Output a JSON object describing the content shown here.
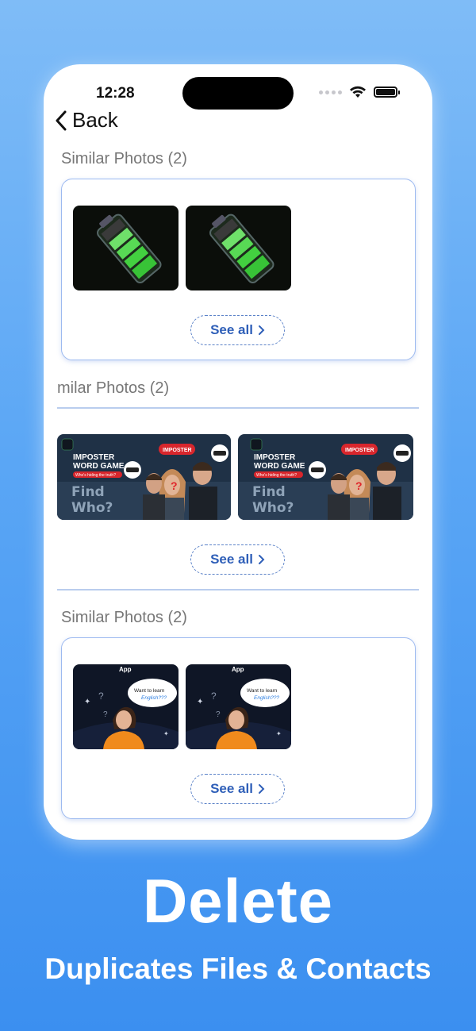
{
  "status_bar": {
    "time": "12:28"
  },
  "nav": {
    "back_label": "Back"
  },
  "groups": [
    {
      "title": "Similar Photos (2)",
      "see_all_label": "See all"
    },
    {
      "title": "milar Photos (2)",
      "see_all_label": "See all"
    },
    {
      "title": "Similar Photos (2)",
      "see_all_label": "See all"
    }
  ],
  "thumbnails": {
    "ad_banner": {
      "line1": "IMPOSTER",
      "line2": "WORD GAME",
      "tagline": "Who's hiding the truth?",
      "badge": "IMPOSTER",
      "graffiti_1": "Find",
      "graffiti_2": "Who?"
    },
    "learn_english": {
      "app": "App",
      "bubble_1": "Want to learn",
      "bubble_2": "English???"
    }
  },
  "promo": {
    "headline": "Delete",
    "subhead": "Duplicates Files & Contacts"
  },
  "colors": {
    "background_top": "#7fbcf7",
    "background_bottom": "#3b8ff0",
    "card_border": "#9dbaf0",
    "see_all": "#2f5fb8"
  }
}
